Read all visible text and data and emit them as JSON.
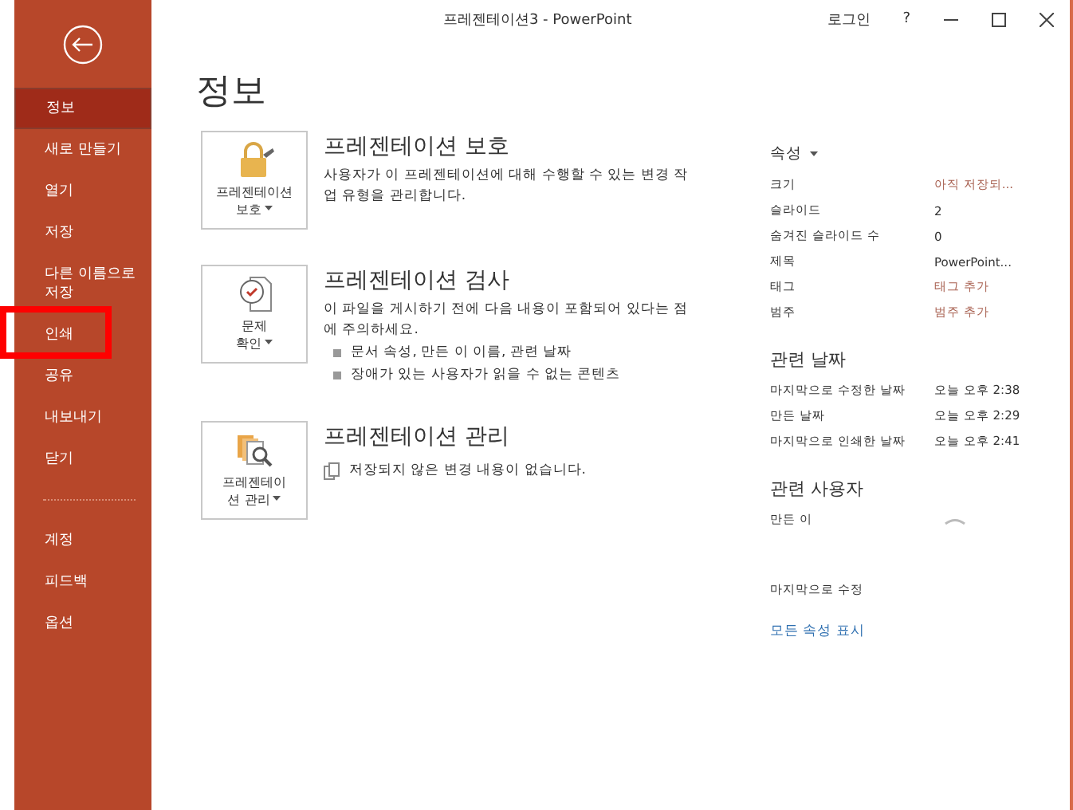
{
  "window": {
    "title": "프레젠테이션3 - PowerPoint",
    "sign_in": "로그인",
    "help": "?"
  },
  "sidebar": {
    "groups": [
      [
        {
          "label": "정보",
          "selected": true,
          "marked": false
        },
        {
          "label": "새로 만들기",
          "selected": false,
          "marked": false
        },
        {
          "label": "열기",
          "selected": false,
          "marked": false
        },
        {
          "label": "저장",
          "selected": false,
          "marked": false
        },
        {
          "label": "다른 이름으로 저장",
          "selected": false,
          "marked": false
        },
        {
          "label": "인쇄",
          "selected": false,
          "marked": true
        },
        {
          "label": "공유",
          "selected": false,
          "marked": false
        },
        {
          "label": "내보내기",
          "selected": false,
          "marked": false
        },
        {
          "label": "닫기",
          "selected": false,
          "marked": false
        }
      ],
      [
        {
          "label": "계정",
          "selected": false,
          "marked": false
        },
        {
          "label": "피드백",
          "selected": false,
          "marked": false
        },
        {
          "label": "옵션",
          "selected": false,
          "marked": false
        }
      ]
    ]
  },
  "page_title": "정보",
  "sections": [
    {
      "kind": "lock",
      "button_lines": [
        "프레젠테이션",
        "보호"
      ],
      "title": "프레젠테이션 보호",
      "description": "사용자가 이 프레젠테이션에 대해 수행할 수 있는 변경 작업 유형을 관리합니다."
    },
    {
      "kind": "inspect",
      "button_lines": [
        "문제",
        "확인"
      ],
      "title": "프레젠테이션 검사",
      "description": "이 파일을 게시하기 전에 다음 내용이 포함되어 있다는 점에 주의하세요.",
      "bullets": [
        "문서 속성, 만든 이 이름, 관련 날짜",
        "장애가 있는 사용자가 읽을 수 없는 콘텐츠"
      ]
    },
    {
      "kind": "manage",
      "button_lines": [
        "프레젠테이",
        "션 관리"
      ],
      "title": "프레젠테이션 관리",
      "note": "저장되지 않은 변경 내용이 없습니다."
    }
  ],
  "properties": {
    "heading": "속성",
    "rows": [
      {
        "label": "크기",
        "value": "아직 저장되...",
        "kind": "placeholder"
      },
      {
        "label": "슬라이드",
        "value": "2",
        "kind": "value"
      },
      {
        "label": "숨겨진 슬라이드 수",
        "value": "0",
        "kind": "value"
      },
      {
        "label": "제목",
        "value": "PowerPoint...",
        "kind": "value"
      },
      {
        "label": "태그",
        "value": "태그 추가",
        "kind": "placeholder"
      },
      {
        "label": "범주",
        "value": "범주 추가",
        "kind": "placeholder"
      }
    ]
  },
  "related_dates": {
    "heading": "관련 날짜",
    "rows": [
      {
        "label": "마지막으로 수정한 날짜",
        "value": "오늘 오후 2:38"
      },
      {
        "label": "만든 날짜",
        "value": "오늘 오후 2:29"
      },
      {
        "label": "마지막으로 인쇄한 날짜",
        "value": "오늘 오후 2:41"
      }
    ]
  },
  "related_people": {
    "heading": "관련 사용자",
    "rows": [
      {
        "label": "만든 이",
        "loading": true
      },
      {
        "label": "마지막으로 수정",
        "loading": false
      }
    ]
  },
  "show_all_link": "모든 속성 표시"
}
